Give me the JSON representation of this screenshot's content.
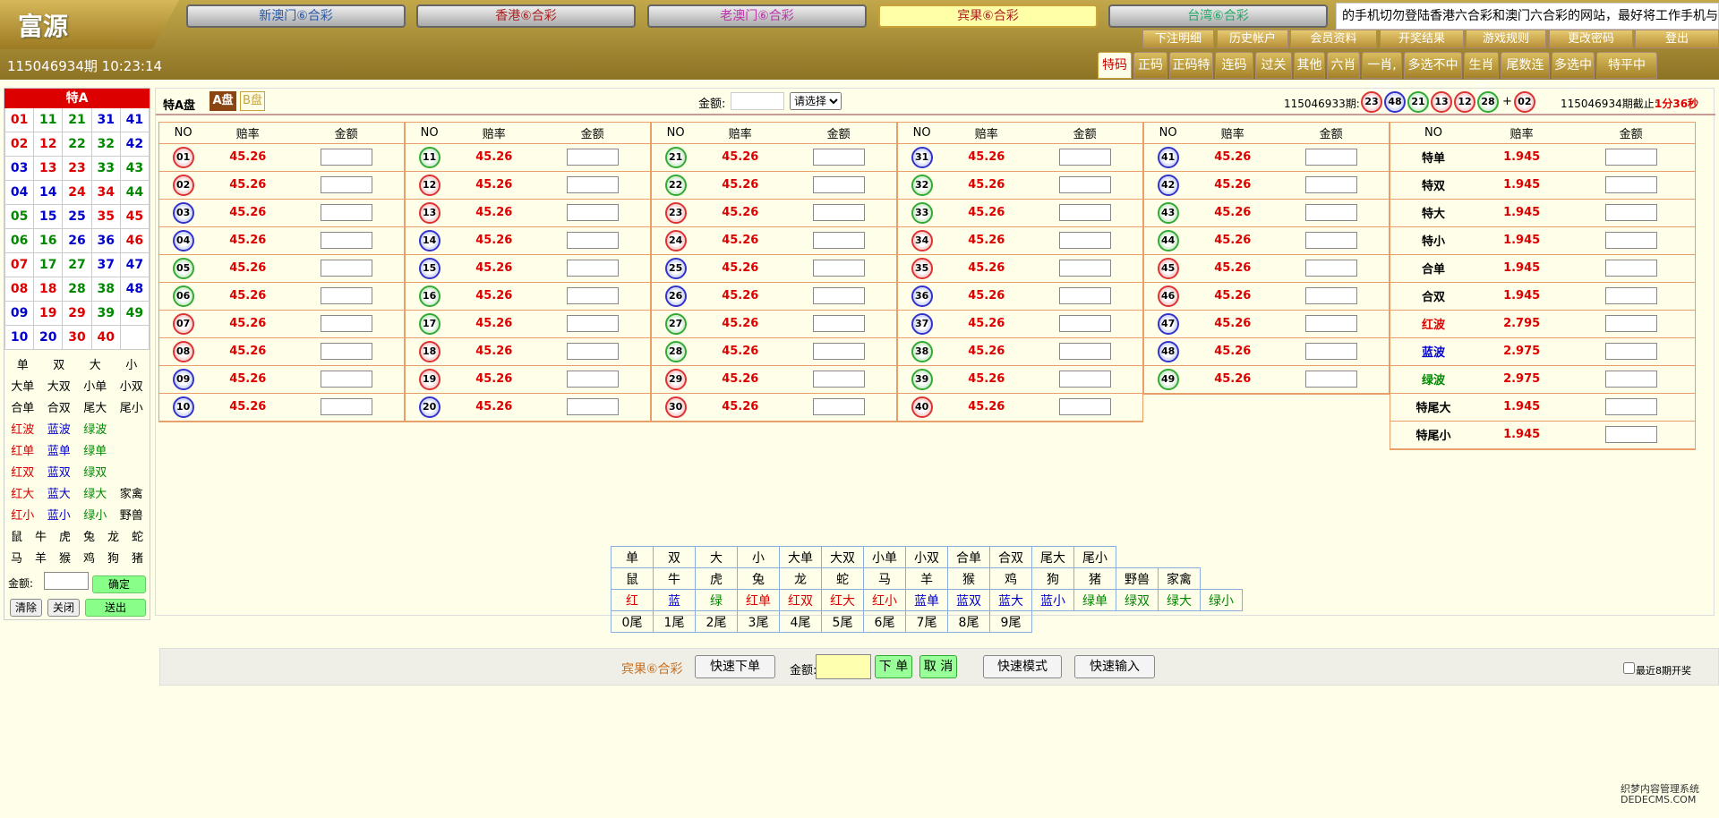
{
  "logo": "富源",
  "lottery_tabs": [
    "新澳门⑥合彩",
    "香港⑥合彩",
    "老澳门⑥合彩",
    "宾果⑥合彩",
    "台湾⑥合彩"
  ],
  "marquee": "的手机切勿登陆香港六合彩和澳门六合彩的网站，最好将工作手机与",
  "period_time": "115046934期 10:23:14",
  "sub_menu": [
    "下注明细",
    "历史帐户",
    "会员资料",
    "开奖结果",
    "游戏规则",
    "更改密码",
    "登出"
  ],
  "nav_tabs": [
    "特码",
    "正码",
    "正码特",
    "连码",
    "过关",
    "其他",
    "六肖",
    "一肖,尾数",
    "多选不中",
    "生肖连",
    "尾数连",
    "多选中一",
    "特平中"
  ],
  "left": {
    "header": "特A",
    "nums": [
      [
        "01",
        "11",
        "21",
        "31",
        "41"
      ],
      [
        "02",
        "12",
        "22",
        "32",
        "42"
      ],
      [
        "03",
        "13",
        "23",
        "33",
        "43"
      ],
      [
        "04",
        "14",
        "24",
        "34",
        "44"
      ],
      [
        "05",
        "15",
        "25",
        "35",
        "45"
      ],
      [
        "06",
        "16",
        "26",
        "36",
        "46"
      ],
      [
        "07",
        "17",
        "27",
        "37",
        "47"
      ],
      [
        "08",
        "18",
        "28",
        "38",
        "48"
      ],
      [
        "09",
        "19",
        "29",
        "39",
        "49"
      ],
      [
        "10",
        "20",
        "30",
        "40",
        ""
      ]
    ],
    "quick": [
      "单",
      "双",
      "大",
      "小",
      "大单",
      "大双",
      "小单",
      "小双",
      "合单",
      "合双",
      "尾大",
      "尾小",
      "红波",
      "蓝波",
      "绿波",
      "",
      "红单",
      "蓝单",
      "绿单",
      "",
      "红双",
      "蓝双",
      "绿双",
      "",
      "红大",
      "蓝大",
      "绿大",
      "家禽",
      "红小",
      "蓝小",
      "绿小",
      "野兽"
    ],
    "zodiac": [
      "鼠",
      "牛",
      "虎",
      "兔",
      "龙",
      "蛇",
      "马",
      "羊",
      "猴",
      "鸡",
      "狗",
      "猪"
    ],
    "amount_label": "金额:",
    "confirm": "确定",
    "clear": "清除",
    "close": "关闭",
    "submit": "送出"
  },
  "toolbar": {
    "title": "特A盘",
    "plate_a": "A盘",
    "plate_b": "B盘",
    "amount_label": "金额:",
    "select_placeholder": "请选择",
    "last_period": "115046933期:",
    "draw": [
      "23",
      "48",
      "21",
      "13",
      "12",
      "28",
      "02"
    ],
    "plus": "+",
    "deadline": "115046934期截止:",
    "countdown": "1分36秒"
  },
  "table_headers": [
    "NO",
    "赔率",
    "金额"
  ],
  "odds": "45.26",
  "special": [
    {
      "name": "特单",
      "odds": "1.945"
    },
    {
      "name": "特双",
      "odds": "1.945"
    },
    {
      "name": "特大",
      "odds": "1.945"
    },
    {
      "name": "特小",
      "odds": "1.945"
    },
    {
      "name": "合单",
      "odds": "1.945"
    },
    {
      "name": "合双",
      "odds": "1.945"
    },
    {
      "name": "红波",
      "odds": "2.795"
    },
    {
      "name": "蓝波",
      "odds": "2.975"
    },
    {
      "name": "绿波",
      "odds": "2.975"
    },
    {
      "name": "特尾大",
      "odds": "1.945"
    },
    {
      "name": "特尾小",
      "odds": "1.945"
    }
  ],
  "quick_table": [
    [
      "单",
      "双",
      "大",
      "小",
      "大单",
      "大双",
      "小单",
      "小双",
      "合单",
      "合双",
      "尾大",
      "尾小"
    ],
    [
      "鼠",
      "牛",
      "虎",
      "兔",
      "龙",
      "蛇",
      "马",
      "羊",
      "猴",
      "鸡",
      "狗",
      "猪",
      "野兽",
      "家禽"
    ],
    [
      "红",
      "蓝",
      "绿",
      "红单",
      "红双",
      "红大",
      "红小",
      "蓝单",
      "蓝双",
      "蓝大",
      "蓝小",
      "绿单",
      "绿双",
      "绿大",
      "绿小"
    ],
    [
      "0尾",
      "1尾",
      "2尾",
      "3尾",
      "4尾",
      "5尾",
      "6尾",
      "7尾",
      "8尾",
      "9尾"
    ]
  ],
  "bottom": {
    "game": "宾果⑥合彩",
    "fast_order": "快速下单",
    "amount_label": "金额:",
    "order": "下 单",
    "cancel": "取 消",
    "fast_mode": "快速模式",
    "fast_input": "快速输入",
    "recent": "最近8期开奖"
  },
  "watermark": "织梦内容管理系统 DEDECMS.COM",
  "colors": {
    "red": "#dd0000",
    "blue": "#0000cc",
    "green": "#008800",
    "gold": "#a5822a"
  }
}
